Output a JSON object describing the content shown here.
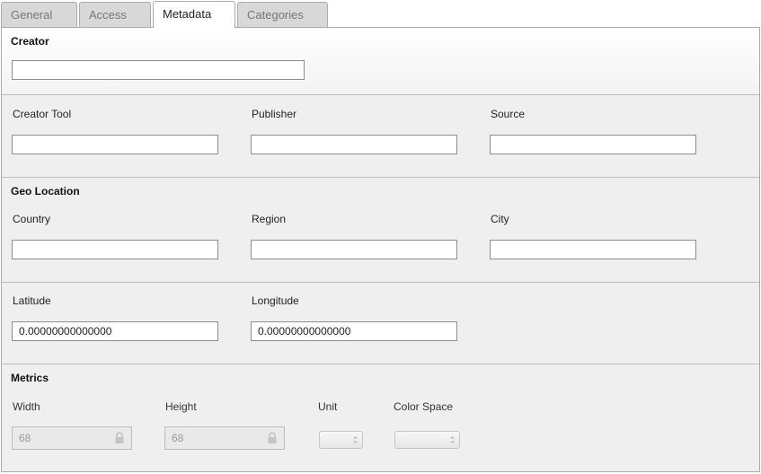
{
  "tabs": [
    {
      "label": "General",
      "active": false
    },
    {
      "label": "Access",
      "active": false
    },
    {
      "label": "Metadata",
      "active": true
    },
    {
      "label": "Categories",
      "active": false
    }
  ],
  "creator": {
    "heading": "Creator",
    "value": ""
  },
  "production": {
    "creator_tool": {
      "label": "Creator Tool",
      "value": ""
    },
    "publisher": {
      "label": "Publisher",
      "value": ""
    },
    "source": {
      "label": "Source",
      "value": ""
    }
  },
  "geo_location": {
    "heading": "Geo Location",
    "country": {
      "label": "Country",
      "value": ""
    },
    "region": {
      "label": "Region",
      "value": ""
    },
    "city": {
      "label": "City",
      "value": ""
    }
  },
  "coordinates": {
    "latitude": {
      "label": "Latitude",
      "value": "0.00000000000000"
    },
    "longitude": {
      "label": "Longitude",
      "value": "0.00000000000000"
    }
  },
  "metrics": {
    "heading": "Metrics",
    "width": {
      "label": "Width",
      "value": "68",
      "locked": true
    },
    "height": {
      "label": "Height",
      "value": "68",
      "locked": true
    },
    "unit": {
      "label": "Unit",
      "value": ""
    },
    "color_space": {
      "label": "Color Space",
      "value": ""
    }
  },
  "colors": {
    "panel_bg": "#efefef",
    "border": "#aaaaaa",
    "tab_inactive_bg": "#d8d8d8",
    "tab_inactive_text": "#777777"
  }
}
